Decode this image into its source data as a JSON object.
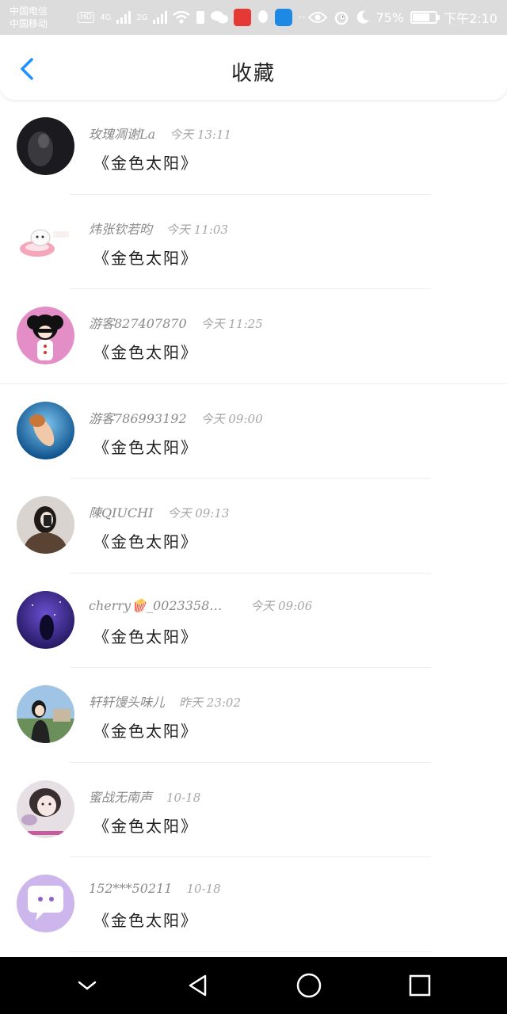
{
  "status_bar": {
    "carrier1": "中国电信",
    "carrier2": "中国移动",
    "hd": "HD",
    "net1": "4G",
    "net2": "2G",
    "more": "··",
    "battery_percent": "75%",
    "battery_level": 0.75,
    "time": "下午2:10"
  },
  "header": {
    "title": "收藏",
    "back_icon": "chevron-left-icon"
  },
  "favorites": [
    {
      "name": "玫瑰凋谢La",
      "time": "今天 13:11",
      "title": "《金色太阳》",
      "avatar": "dark-portrait"
    },
    {
      "name": "炜张钦若昀",
      "time": "今天 11:03",
      "title": "《金色太阳》",
      "avatar": "cartoon-donut"
    },
    {
      "name": "游客827407870",
      "time": "今天 11:25",
      "title": "《金色太阳》",
      "avatar": "cartoon-girl"
    },
    {
      "name": "游客786993192",
      "time": "今天 09:00",
      "title": "《金色太阳》",
      "avatar": "underwater-girl"
    },
    {
      "name": "陳QIUCHI",
      "time": "今天 09:13",
      "title": "《金色太阳》",
      "avatar": "girl-selfie"
    },
    {
      "name": "cherry🍿_0023358…",
      "time": "今天 09:06",
      "title": "《金色太阳》",
      "avatar": "purple-night"
    },
    {
      "name": "轩轩馒头味儿",
      "time": "昨天 23:02",
      "title": "《金色太阳》",
      "avatar": "girl-landscape"
    },
    {
      "name": "蜜战无南声",
      "time": "10-18",
      "title": "《金色太阳》",
      "avatar": "girl-closeup"
    },
    {
      "name": "152***50211",
      "time": "10-18",
      "title": "《金色太阳》",
      "avatar": "chat-bubble"
    }
  ],
  "nav": {
    "collapse_icon": "chevron-down-icon",
    "back_icon": "triangle-back-icon",
    "home_icon": "circle-home-icon",
    "recents_icon": "square-recents-icon"
  }
}
